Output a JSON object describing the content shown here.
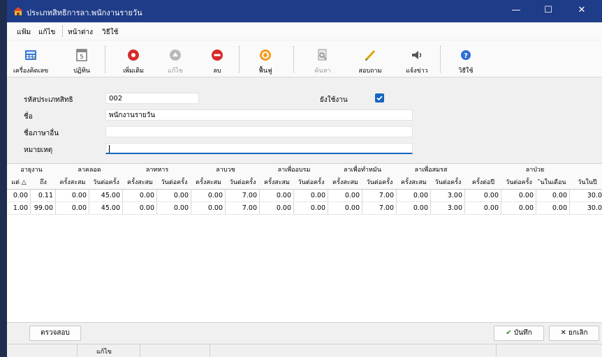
{
  "window": {
    "title": "ประเภทสิทธิการลา.พนักงานรายวัน",
    "controls": {
      "minimize": "—",
      "maximize": "☐",
      "close": "✕"
    }
  },
  "menu": {
    "items": [
      "แฟ้ม",
      "แก้ไข",
      "หน้าต่าง",
      "วิธีใช้"
    ]
  },
  "toolbar": {
    "buttons": [
      {
        "label": "เครื่องคิดเลข",
        "icon": "calculator-icon",
        "enabled": true
      },
      {
        "label": "ปฏิทิน",
        "icon": "calendar-icon",
        "enabled": true
      },
      {
        "label": "เพิ่มเติม",
        "icon": "add-circle-icon",
        "enabled": true
      },
      {
        "label": "แก้ไข",
        "icon": "edit-circle-icon",
        "enabled": false
      },
      {
        "label": "ลบ",
        "icon": "delete-circle-icon",
        "enabled": true
      },
      {
        "label": "ฟื้นฟู",
        "icon": "refresh-circle-icon",
        "enabled": true
      },
      {
        "label": "ค้นหา",
        "icon": "search-icon",
        "enabled": false
      },
      {
        "label": "สอบถาม",
        "icon": "query-pen-icon",
        "enabled": true
      },
      {
        "label": "แจ้งข่าว",
        "icon": "speaker-icon",
        "enabled": true
      },
      {
        "label": "วิธีใช้",
        "icon": "help-icon",
        "enabled": true
      }
    ]
  },
  "form": {
    "code_label": "รหัสประเภทสิทธิ",
    "code_value": "002",
    "active_label": "ยังใช้งาน",
    "active_checked": true,
    "name_label": "ชื่อ",
    "name_value": "พนักงานรายวัน",
    "other_lang_label": "ชื่อภาษาอื่น",
    "other_lang_value": "",
    "note_label": "หมายเหตุ",
    "note_value": "",
    "active_color": "#1565c0"
  },
  "grid": {
    "group_headers": [
      "อายุงาน",
      "ลาคลอด",
      "ลาทหาร",
      "ลาบวช",
      "ลาเพื่ออบรม",
      "ลาเพื่อทำหมัน",
      "ลาเพื่อสมรส",
      "ลาป่วย"
    ],
    "sub_headers": [
      "แต่ △",
      "ถึง",
      "ครั้งสะสม",
      "วันต่อครั้ง",
      "ครั้งสะสม",
      "วันต่อครั้ง",
      "ครั้งสะสม",
      "วันต่อครั้ง",
      "ครั้งสะสม",
      "วันต่อครั้ง",
      "ครั้งสะสม",
      "วันต่อครั้ง",
      "ครั้งสะสม",
      "วันต่อครั้ง",
      "ครั้งต่อปี",
      "วันต่อครั้ง",
      "ันในเดือน",
      "วันในปี"
    ],
    "rows": [
      [
        "0.00",
        "0.11",
        "0.00",
        "45.00",
        "0.00",
        "0.00",
        "0.00",
        "7.00",
        "0.00",
        "0.00",
        "0.00",
        "7.00",
        "0.00",
        "3.00",
        "0.00",
        "0.00",
        "0.00",
        "30.0"
      ],
      [
        "1.00",
        "99.00",
        "0.00",
        "45.00",
        "0.00",
        "0.00",
        "0.00",
        "7.00",
        "0.00",
        "0.00",
        "0.00",
        "7.00",
        "0.00",
        "3.00",
        "0.00",
        "0.00",
        "0.00",
        "30.0"
      ]
    ]
  },
  "footer": {
    "verify_label": "ตรวจสอบ",
    "save_label": "บันทึก",
    "cancel_label": "ยกเลิก",
    "save_icon": "check-icon",
    "cancel_icon": "x-icon"
  },
  "status": {
    "mode_text": "แก้ไข"
  }
}
